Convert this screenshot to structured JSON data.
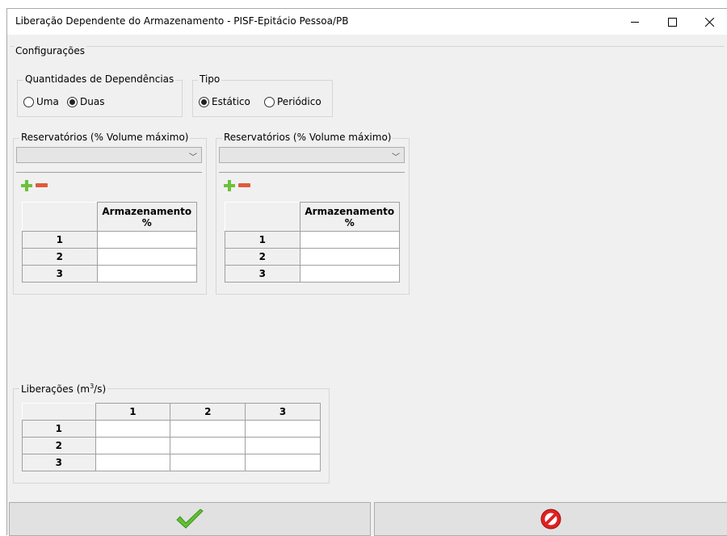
{
  "window": {
    "title": "Liberação Dependente do Armazenamento - PISF-Epitácio Pessoa/PB",
    "minimize_glyph": "—",
    "maximize_glyph": "☐",
    "close_glyph": "✕"
  },
  "config": {
    "label": "Configurações",
    "dependencias": {
      "label": "Quantidades de Dependências",
      "options": [
        "Uma",
        "Duas"
      ],
      "selected": "Duas"
    },
    "tipo": {
      "label": "Tipo",
      "options": [
        "Estático",
        "Periódico"
      ],
      "selected": "Estático"
    }
  },
  "reservatorios": [
    {
      "label": "Reservatórios (% Volume máximo)",
      "combo_value": "",
      "table": {
        "header_line1": "Armazenamento",
        "header_line2": "%",
        "rows": [
          "1",
          "2",
          "3"
        ]
      }
    },
    {
      "label": "Reservatórios (% Volume máximo)",
      "combo_value": "",
      "table": {
        "header_line1": "Armazenamento",
        "header_line2": "%",
        "rows": [
          "1",
          "2",
          "3"
        ]
      }
    }
  ],
  "liberacoes": {
    "label_prefix": "Liberações (m",
    "label_sup": "3",
    "label_suffix": "/s)",
    "columns": [
      "1",
      "2",
      "3"
    ],
    "rows": [
      "1",
      "2",
      "3"
    ]
  },
  "buttons": {
    "confirm_icon": "check-icon",
    "cancel_icon": "forbidden-icon"
  },
  "colors": {
    "plus": "#6cc13b",
    "minus": "#e05a3a",
    "check": "#62c131",
    "cancel": "#e02020"
  }
}
